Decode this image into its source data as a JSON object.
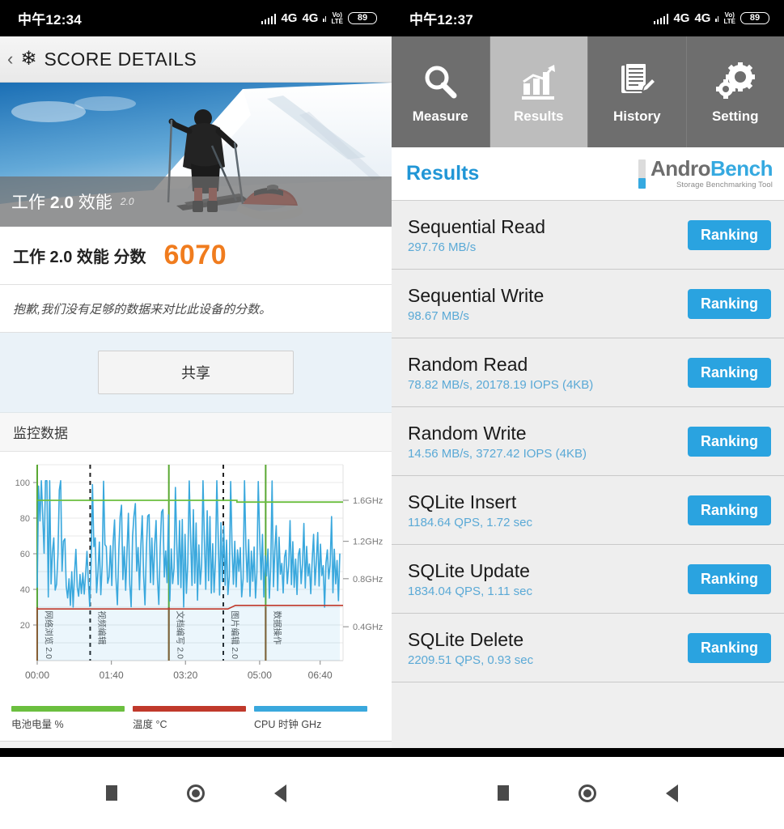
{
  "left_phone": {
    "statusbar": {
      "time": "中午12:34",
      "network1": "4G",
      "network2": "4G",
      "volte_top": "Vo)",
      "volte_bottom": "LTE",
      "battery": "89"
    },
    "header": {
      "back_icon": "‹",
      "snowflake_icon": "❄",
      "title": "SCORE DETAILS"
    },
    "hero": {
      "caption_main_1": "工作 ",
      "caption_main_bold": "2.0",
      "caption_main_2": " 效能",
      "caption_version": "2.0"
    },
    "score": {
      "label": "工作 2.0 效能 分数",
      "value": "6070",
      "accent_color": "#f07c1e"
    },
    "note": {
      "text": "抱歉,我们没有足够的数据来对比此设备的分数。"
    },
    "share": {
      "label": "共享"
    },
    "monitor": {
      "title": "监控数据"
    }
  },
  "chart_data": {
    "type": "line",
    "title": "监控数据",
    "xlabel": "",
    "ylabel": "",
    "grid": true,
    "legend_position": "bottom",
    "x_ticks": [
      "00:00",
      "01:40",
      "03:20",
      "05:00",
      "06:40"
    ],
    "y_left_ticks": [
      "20",
      "40",
      "60",
      "80",
      "100"
    ],
    "y_left_range": [
      0,
      110
    ],
    "y_right_ticks": [
      "0.4GHz",
      "0.8GHz",
      "1.2GHz",
      "1.6GHz"
    ],
    "y_right_range": [
      0.0,
      1.9
    ],
    "annotations": [
      {
        "label": "网络浏览 2.0",
        "x_time": "00:00",
        "style": "solid-green"
      },
      {
        "label": "视频编辑",
        "x_time": "01:12",
        "style": "dashed-black"
      },
      {
        "label": "文档编写 2.0",
        "x_time": "02:56",
        "style": "solid-green"
      },
      {
        "label": "图片编辑 2.0",
        "x_time": "04:10",
        "style": "dashed-black"
      },
      {
        "label": "数据操作",
        "x_time": "05:06",
        "style": "solid-green"
      }
    ],
    "series": [
      {
        "name": "电池电量 %",
        "color": "#6bbf3f",
        "unit": "%",
        "values": [
          90,
          90,
          90,
          90,
          90,
          90,
          90,
          90,
          90,
          90,
          90,
          90,
          90,
          90,
          90,
          90,
          90,
          90,
          90,
          90,
          90,
          90,
          90,
          90,
          90,
          90,
          90,
          90,
          90,
          90,
          90,
          90,
          90,
          90,
          90,
          90,
          90,
          90,
          90,
          90,
          89,
          89,
          89,
          89,
          89,
          89,
          89,
          89,
          89,
          89,
          89,
          89,
          89,
          89,
          89,
          89,
          89,
          89,
          89,
          89
        ]
      },
      {
        "name": "温度 °C",
        "color": "#c0392b",
        "unit": "°C",
        "values": [
          29,
          29,
          29,
          29,
          29,
          29,
          29,
          29,
          29,
          29,
          29,
          29,
          29,
          29,
          29,
          29,
          29,
          29,
          29,
          29,
          29,
          29,
          29,
          29,
          29,
          29,
          29,
          29,
          29,
          29,
          29,
          29,
          29,
          29,
          29,
          29,
          29,
          29,
          30,
          31,
          31,
          31,
          31,
          31,
          31,
          31,
          31,
          31,
          31,
          31,
          31,
          31,
          31,
          31,
          31,
          31,
          31,
          31,
          31,
          31
        ]
      },
      {
        "name": "CPU 时钟 GHz",
        "color": "#3aa8dd",
        "unit": "GHz",
        "values": [
          0.4,
          1.9,
          1.55,
          1.9,
          1.55,
          1.2,
          1.9,
          1.9,
          1.25,
          1.25,
          1.9,
          1.9,
          0.9,
          1.25,
          1.25,
          0.85,
          0.85,
          1.25,
          0.65,
          0.65,
          0.9,
          0.9,
          0.65,
          0.65,
          0.9,
          1.25,
          0.65,
          0.75,
          1.25,
          0.9,
          1.9,
          1.25,
          1.0,
          1.55,
          1.7,
          1.25,
          1.0,
          1.25,
          1.25,
          1.25,
          0.9,
          1.5,
          0.75,
          1.25,
          1.55,
          1.55,
          0.9,
          1.9,
          1.25,
          0.9,
          1.25,
          1.0,
          0.75,
          1.25,
          0.9,
          1.25,
          1.45,
          1.0,
          1.25,
          1.1
        ]
      }
    ],
    "legend": [
      {
        "label": "电池电量 %",
        "color": "#6bbf3f"
      },
      {
        "label": "温度 °C",
        "color": "#c0392b"
      },
      {
        "label": "CPU 时钟 GHz",
        "color": "#3aa8dd"
      }
    ]
  },
  "right_phone": {
    "statusbar": {
      "time": "中午12:37",
      "network1": "4G",
      "network2": "4G",
      "volte_top": "Vo)",
      "volte_bottom": "LTE",
      "battery": "89"
    },
    "tabs": [
      {
        "label": "Measure",
        "icon": "magnifier-icon",
        "active": false
      },
      {
        "label": "Results",
        "icon": "bar-chart-icon",
        "active": true
      },
      {
        "label": "History",
        "icon": "document-pencil-icon",
        "active": false
      },
      {
        "label": "Setting",
        "icon": "gears-icon",
        "active": false
      }
    ],
    "results_header": {
      "title": "Results",
      "brand_part1": "Andro",
      "brand_part2": "Bench",
      "brand_tagline": "Storage Benchmarking Tool"
    },
    "rows": [
      {
        "title": "Sequential Read",
        "value": "297.76 MB/s",
        "button": "Ranking"
      },
      {
        "title": "Sequential Write",
        "value": "98.67 MB/s",
        "button": "Ranking"
      },
      {
        "title": "Random Read",
        "value": "78.82 MB/s, 20178.19 IOPS (4KB)",
        "button": "Ranking"
      },
      {
        "title": "Random Write",
        "value": "14.56 MB/s, 3727.42 IOPS (4KB)",
        "button": "Ranking"
      },
      {
        "title": "SQLite Insert",
        "value": "1184.64 QPS, 1.72 sec",
        "button": "Ranking"
      },
      {
        "title": "SQLite Update",
        "value": "1834.04 QPS, 1.11 sec",
        "button": "Ranking"
      },
      {
        "title": "SQLite Delete",
        "value": "2209.51 QPS, 0.93 sec",
        "button": "Ranking"
      }
    ]
  },
  "navbar": {
    "recent_icon": "square",
    "home_icon": "circle",
    "back_icon": "triangle-left"
  }
}
